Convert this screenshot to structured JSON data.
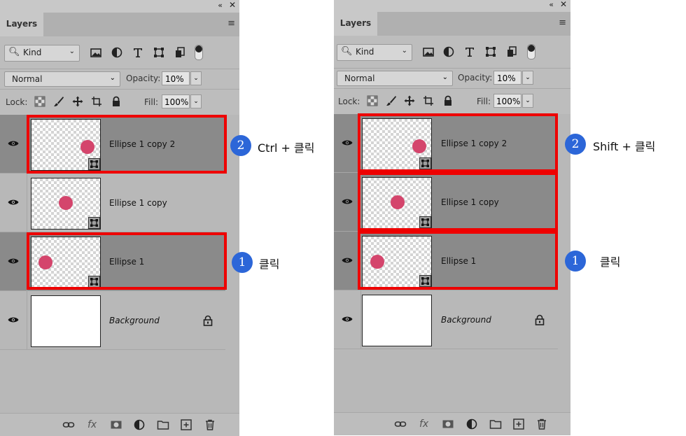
{
  "panels": [
    {
      "tab_label": "Layers",
      "kind_label": "Kind",
      "blend_mode": "Normal",
      "opacity_label": "Opacity:",
      "opacity_value": "10%",
      "lock_label": "Lock:",
      "fill_label": "Fill:",
      "fill_value": "100%",
      "layers": [
        {
          "name": "Ellipse 1 copy 2",
          "selected": true
        },
        {
          "name": "Ellipse 1 copy",
          "selected": false
        },
        {
          "name": "Ellipse 1",
          "selected": true
        },
        {
          "name": "Background",
          "selected": false
        }
      ],
      "annotations": [
        {
          "number": "2",
          "text": "Ctrl + 클릭"
        },
        {
          "number": "1",
          "text": "클릭"
        }
      ]
    },
    {
      "tab_label": "Layers",
      "kind_label": "Kind",
      "blend_mode": "Normal",
      "opacity_label": "Opacity:",
      "opacity_value": "10%",
      "lock_label": "Lock:",
      "fill_label": "Fill:",
      "fill_value": "100%",
      "layers": [
        {
          "name": "Ellipse 1 copy 2",
          "selected": true
        },
        {
          "name": "Ellipse 1 copy",
          "selected": true
        },
        {
          "name": "Ellipse 1",
          "selected": true
        },
        {
          "name": "Background",
          "selected": false
        }
      ],
      "annotations": [
        {
          "number": "2",
          "text": "Shift + 클릭"
        },
        {
          "number": "1",
          "text": "클릭"
        }
      ]
    }
  ],
  "colors": {
    "highlight": "#ee0000",
    "badge": "#2c66d8",
    "ellipse": "#d4456c",
    "selected_row": "#8a8a8a"
  }
}
